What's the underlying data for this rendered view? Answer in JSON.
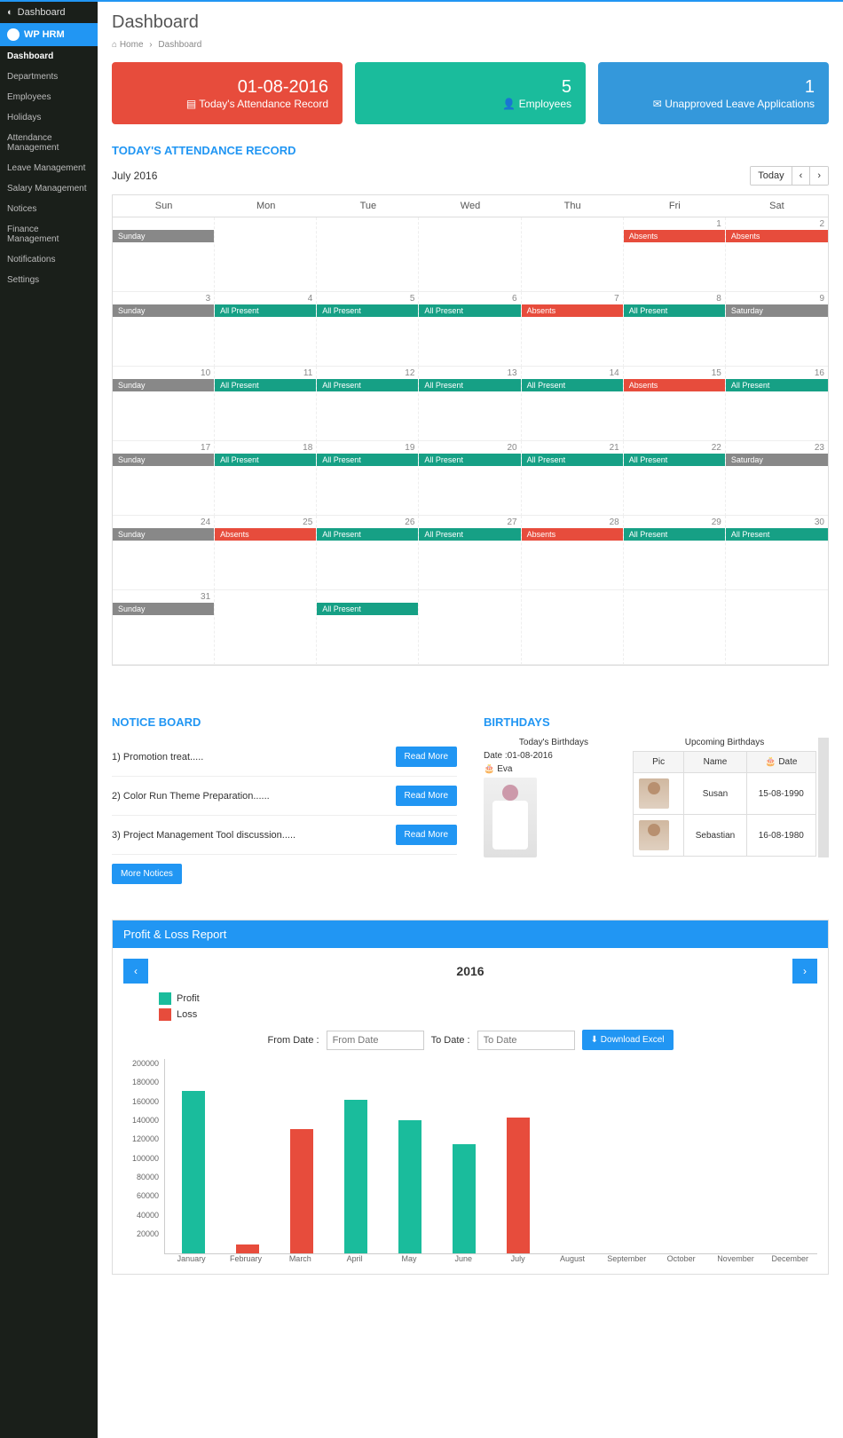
{
  "sidebar": {
    "top": "Dashboard",
    "brand": "WP HRM",
    "items": [
      {
        "label": "Dashboard",
        "current": true
      },
      {
        "label": "Departments"
      },
      {
        "label": "Employees"
      },
      {
        "label": "Holidays"
      },
      {
        "label": "Attendance Management"
      },
      {
        "label": "Leave Management"
      },
      {
        "label": "Salary Management"
      },
      {
        "label": "Notices"
      },
      {
        "label": "Finance Management"
      },
      {
        "label": "Notifications"
      },
      {
        "label": "Settings"
      }
    ]
  },
  "page": {
    "title": "Dashboard"
  },
  "breadcrumb": {
    "home": "Home",
    "current": "Dashboard"
  },
  "cards": {
    "record": {
      "value": "01-08-2016",
      "label": "Today's Attendance Record"
    },
    "employees": {
      "value": "5",
      "label": "Employees"
    },
    "leave": {
      "value": "1",
      "label": "Unapproved Leave Applications"
    }
  },
  "attendance": {
    "title": "TODAY'S ATTENDANCE RECORD",
    "month": "July 2016",
    "today_btn": "Today"
  },
  "dow": [
    "Sun",
    "Mon",
    "Tue",
    "Wed",
    "Thu",
    "Fri",
    "Sat"
  ],
  "event_labels": {
    "sunday": "Sunday",
    "present": "All Present",
    "absent": "Absents",
    "saturday": "Saturday"
  },
  "notice": {
    "title": "NOTICE BOARD",
    "items": [
      {
        "text": "1) Promotion treat....."
      },
      {
        "text": "2) Color Run Theme Preparation......"
      },
      {
        "text": "3) Project Management Tool discussion....."
      }
    ],
    "read_more": "Read More",
    "more": "More Notices"
  },
  "birthdays": {
    "title": "BIRTHDAYS",
    "today_title": "Today's Birthdays",
    "today_date": "Date :01-08-2016",
    "today_name": "Eva",
    "upcoming_title": "Upcoming Birthdays",
    "cols": {
      "pic": "Pic",
      "name": "Name",
      "date": "Date"
    },
    "date_icon": "🎂",
    "rows": [
      {
        "name": "Susan",
        "date": "15-08-1990"
      },
      {
        "name": "Sebastian",
        "date": "16-08-1980"
      }
    ]
  },
  "pl": {
    "title": "Profit & Loss Report",
    "year": "2016",
    "legend": {
      "profit": "Profit",
      "loss": "Loss"
    },
    "from_label": "From Date :",
    "to_label": "To Date :",
    "from_ph": "From Date",
    "to_ph": "To Date",
    "download": "Download Excel"
  },
  "chart_data": {
    "type": "bar",
    "categories": [
      "January",
      "February",
      "March",
      "April",
      "May",
      "June",
      "July",
      "August",
      "September",
      "October",
      "November",
      "December"
    ],
    "series": [
      {
        "name": "Profit",
        "values": [
          183000,
          0,
          0,
          173000,
          150000,
          123000,
          0,
          0,
          0,
          0,
          0,
          0
        ],
        "color": "#1abc9c"
      },
      {
        "name": "Loss",
        "values": [
          0,
          10000,
          140000,
          0,
          0,
          0,
          153000,
          0,
          0,
          0,
          0,
          0
        ],
        "color": "#e74c3c"
      }
    ],
    "ylim": [
      0,
      200000
    ],
    "yticks": [
      200000,
      180000,
      160000,
      140000,
      120000,
      100000,
      80000,
      60000,
      40000,
      20000
    ],
    "xlabel": "",
    "ylabel": ""
  }
}
